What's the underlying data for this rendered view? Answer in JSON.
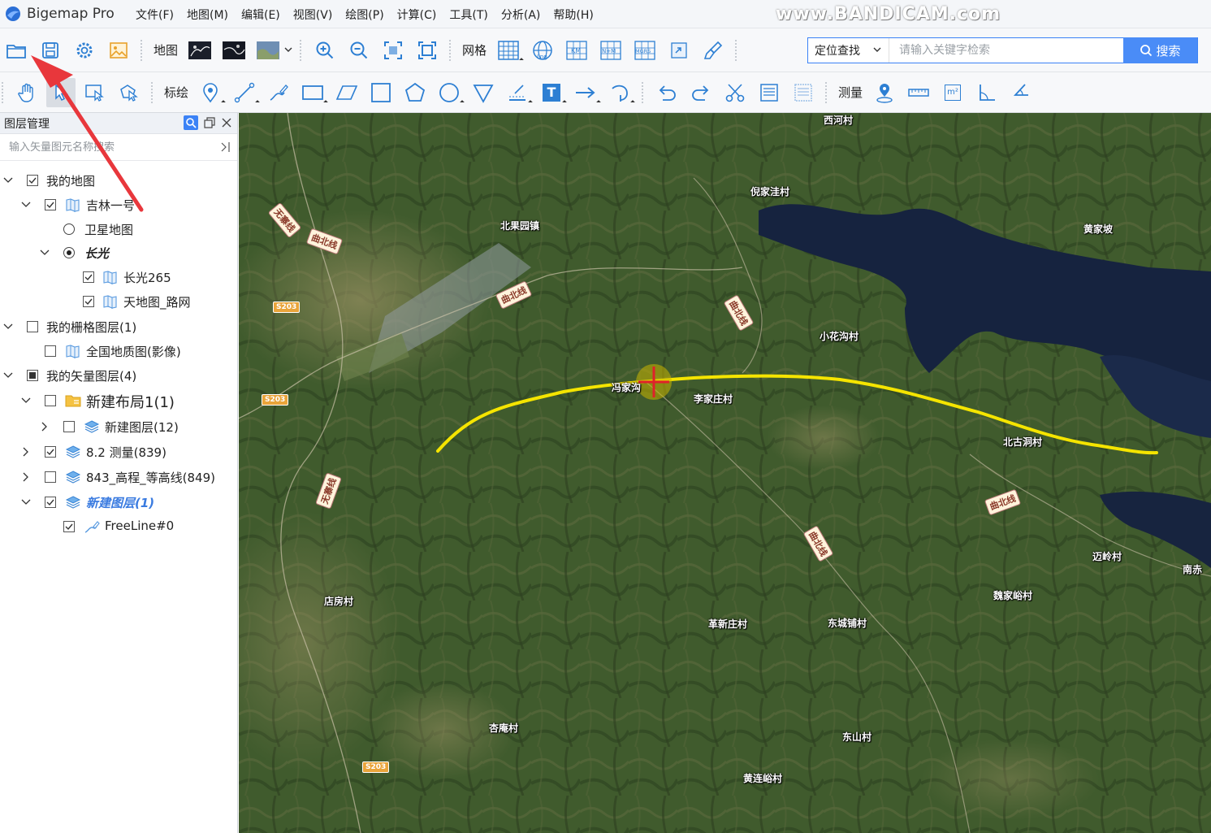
{
  "app": {
    "title": "Bigemap Pro",
    "watermark": "www.BANDICAM.com"
  },
  "menu": [
    "文件(F)",
    "地图(M)",
    "编辑(E)",
    "视图(V)",
    "绘图(P)",
    "计算(C)",
    "工具(T)",
    "分析(A)",
    "帮助(H)"
  ],
  "toolbar1": {
    "map_label": "地图",
    "grid_label": "网格",
    "icons": [
      "open-folder-icon",
      "save-icon",
      "settings-gear-icon",
      "image-icon",
      "map-style-dark-icon",
      "map-style-dark-2-icon",
      "map-style-satellite-icon",
      "zoom-in-icon",
      "zoom-out-icon",
      "zoom-fit-icon",
      "full-extent-icon",
      "grid-icon",
      "lnglat-grid-icon",
      "km-grid-icon",
      "ntm-grid-icon",
      "mgrs-grid-icon",
      "import-icon",
      "clear-brush-icon"
    ],
    "grid_tags": [
      "Lng",
      "KM",
      "N+M",
      "MGRS"
    ]
  },
  "search": {
    "scope": "定位查找",
    "placeholder": "请输入关键字检索",
    "button": "搜索"
  },
  "toolbar2": {
    "draw_label": "标绘",
    "measure_label": "测量",
    "text_tool": "T",
    "area_unit": "m²"
  },
  "sidebar": {
    "title": "图层管理",
    "search_placeholder": "输入矢量图元名称搜索",
    "tree": [
      {
        "label": "我的地图",
        "level": 0,
        "expand": "down",
        "check": "checked"
      },
      {
        "label": "吉林一号",
        "level": 1,
        "expand": "down",
        "check": "checked",
        "icon": "map-book-icon"
      },
      {
        "label": "卫星地图",
        "level": 2,
        "radio": "off"
      },
      {
        "label": "长光",
        "level": 2,
        "expand": "down",
        "radio": "on",
        "style": "bold-italic"
      },
      {
        "label": "长光265",
        "level": 3,
        "check": "checked",
        "icon": "map-book-icon"
      },
      {
        "label": "天地图_路网",
        "level": 3,
        "check": "checked",
        "icon": "map-book-icon"
      },
      {
        "label": "我的栅格图层(1)",
        "level": 0,
        "expand": "down",
        "check": "unchecked"
      },
      {
        "label": "全国地质图(影像)",
        "level": 1,
        "check": "unchecked",
        "icon": "map-book-icon"
      },
      {
        "label": "我的矢量图层(4)",
        "level": 0,
        "expand": "down",
        "check": "partial"
      },
      {
        "label": "新建布局1(1)",
        "level": 1,
        "expand": "down",
        "check": "unchecked",
        "icon": "folder-icon",
        "style": "big"
      },
      {
        "label": "新建图层(12)",
        "level": 2,
        "expand": "right",
        "check": "unchecked",
        "icon": "layers-icon"
      },
      {
        "label": "8.2 测量(839)",
        "level": 1,
        "expand": "right",
        "check": "checked",
        "icon": "layers-icon"
      },
      {
        "label": "843_高程_等高线(849)",
        "level": 1,
        "expand": "right",
        "check": "unchecked",
        "icon": "layers-icon"
      },
      {
        "label": "新建图层(1)",
        "level": 1,
        "expand": "down",
        "check": "checked",
        "icon": "layers-icon",
        "style": "blue-italic"
      },
      {
        "label": "FreeLine#0",
        "level": 2,
        "check": "checked",
        "icon": "freeline-icon"
      }
    ]
  },
  "map": {
    "places": [
      "倪家洼村",
      "北果园镇",
      "黄家坡",
      "小花沟村",
      "冯家沟",
      "李家庄村",
      "北古洞村",
      "迈岭村",
      "南赤",
      "魏家峪村",
      "店房村",
      "革新庄村",
      "东城铺村",
      "杏庵村",
      "东山村",
      "黄连峪村",
      "西河村"
    ],
    "roads": [
      "无寨线",
      "曲北线",
      "曲北线",
      "曲北线",
      "无寨线",
      "曲北线",
      "曲北线"
    ],
    "shields": [
      "S203",
      "S203",
      "S203"
    ],
    "line_color": "#f5e400"
  }
}
